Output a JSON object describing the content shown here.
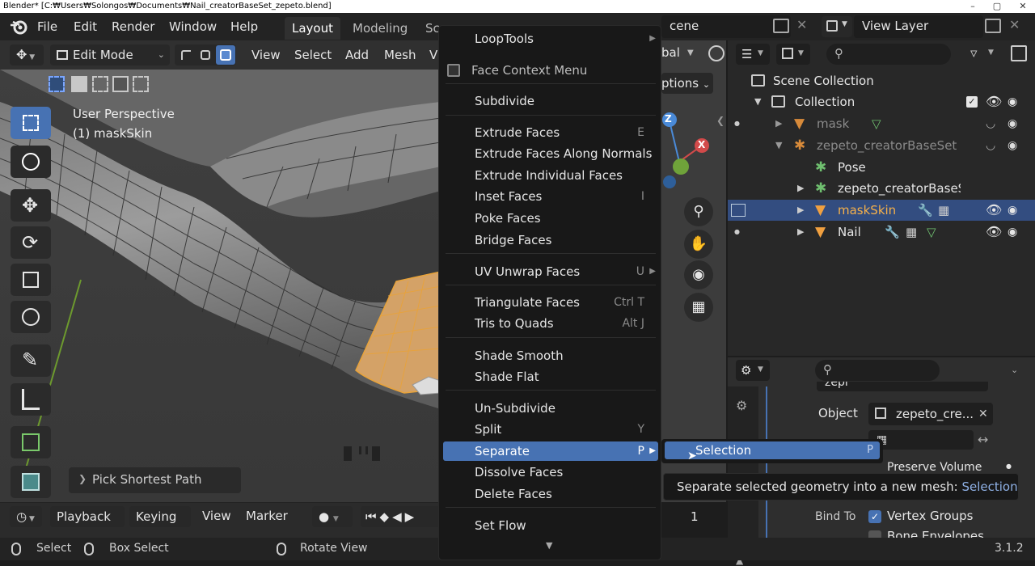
{
  "window_title": "Blender* [C:₩Users₩Solongos₩Documents₩Nail_creatorBaseSet_zepeto.blend]",
  "top_menu": [
    "File",
    "Edit",
    "Render",
    "Window",
    "Help"
  ],
  "workspace_tabs": [
    "Layout",
    "Modeling",
    "Sc"
  ],
  "scene_name": "cene",
  "view_layer": "View Layer",
  "viewport_header": {
    "mode": "Edit Mode",
    "menus": [
      "View",
      "Select",
      "Add",
      "Mesh",
      "V"
    ],
    "transform_orientation": "bal",
    "options": "ptions"
  },
  "viewport": {
    "perspective_label": "User Perspective",
    "object_label": "(1) maskSkin",
    "last_operator": "Pick Shortest Path",
    "gizmo_axes": {
      "z": "Z",
      "x": "X"
    }
  },
  "context_menu": {
    "items": [
      {
        "label": "LoopTools",
        "shortcut": "",
        "submenu": true
      },
      {
        "label": "Face Context Menu",
        "shortcut": "",
        "title": true
      },
      {
        "label": "Subdivide",
        "shortcut": ""
      },
      {
        "label": "Extrude Faces",
        "shortcut": "E"
      },
      {
        "label": "Extrude Faces Along Normals",
        "shortcut": ""
      },
      {
        "label": "Extrude Individual Faces",
        "shortcut": ""
      },
      {
        "label": "Inset Faces",
        "shortcut": "I"
      },
      {
        "label": "Poke Faces",
        "shortcut": ""
      },
      {
        "label": "Bridge Faces",
        "shortcut": ""
      },
      {
        "label": "UV Unwrap Faces",
        "shortcut": "U",
        "submenu": true
      },
      {
        "label": "Triangulate Faces",
        "shortcut": "Ctrl T"
      },
      {
        "label": "Tris to Quads",
        "shortcut": "Alt J"
      },
      {
        "label": "Shade Smooth",
        "shortcut": ""
      },
      {
        "label": "Shade Flat",
        "shortcut": ""
      },
      {
        "label": "Un-Subdivide",
        "shortcut": ""
      },
      {
        "label": "Split",
        "shortcut": "Y"
      },
      {
        "label": "Separate",
        "shortcut": "P",
        "submenu": true,
        "highlighted": true
      },
      {
        "label": "Dissolve Faces",
        "shortcut": ""
      },
      {
        "label": "Delete Faces",
        "shortcut": ""
      },
      {
        "label": "Set Flow",
        "shortcut": ""
      }
    ]
  },
  "submenu": {
    "label": "Selection",
    "shortcut": "P"
  },
  "tooltip": {
    "text": "Separate selected geometry into a new mesh:",
    "value": "Selection"
  },
  "outliner": {
    "rows": [
      {
        "label": "Scene Collection"
      },
      {
        "label": "Collection"
      },
      {
        "label": "mask"
      },
      {
        "label": "zepeto_creatorBaseSet"
      },
      {
        "label": "Pose"
      },
      {
        "label": "zepeto_creatorBaseSe"
      },
      {
        "label": "maskSkin"
      },
      {
        "label": "Nail"
      }
    ]
  },
  "properties": {
    "top_field": "zepi",
    "object_label": "Object",
    "object_value": "zepeto_cre...",
    "preserve_volume": "Preserve Volume",
    "bind_to": "Bind To",
    "vertex_groups": "Vertex Groups",
    "bone_envelopes": "Bone Envelopes",
    "frame_value": "1"
  },
  "timeline": {
    "playback": "Playback",
    "keying": "Keying",
    "view": "View",
    "marker": "Marker"
  },
  "statusbar": {
    "select": "Select",
    "box_select": "Box Select",
    "rotate_view": "Rotate View",
    "version": "3.1.2"
  },
  "colors": {
    "accent": "#4772b3",
    "selected_orange": "#e8a33a",
    "menu_bg": "#181818"
  }
}
